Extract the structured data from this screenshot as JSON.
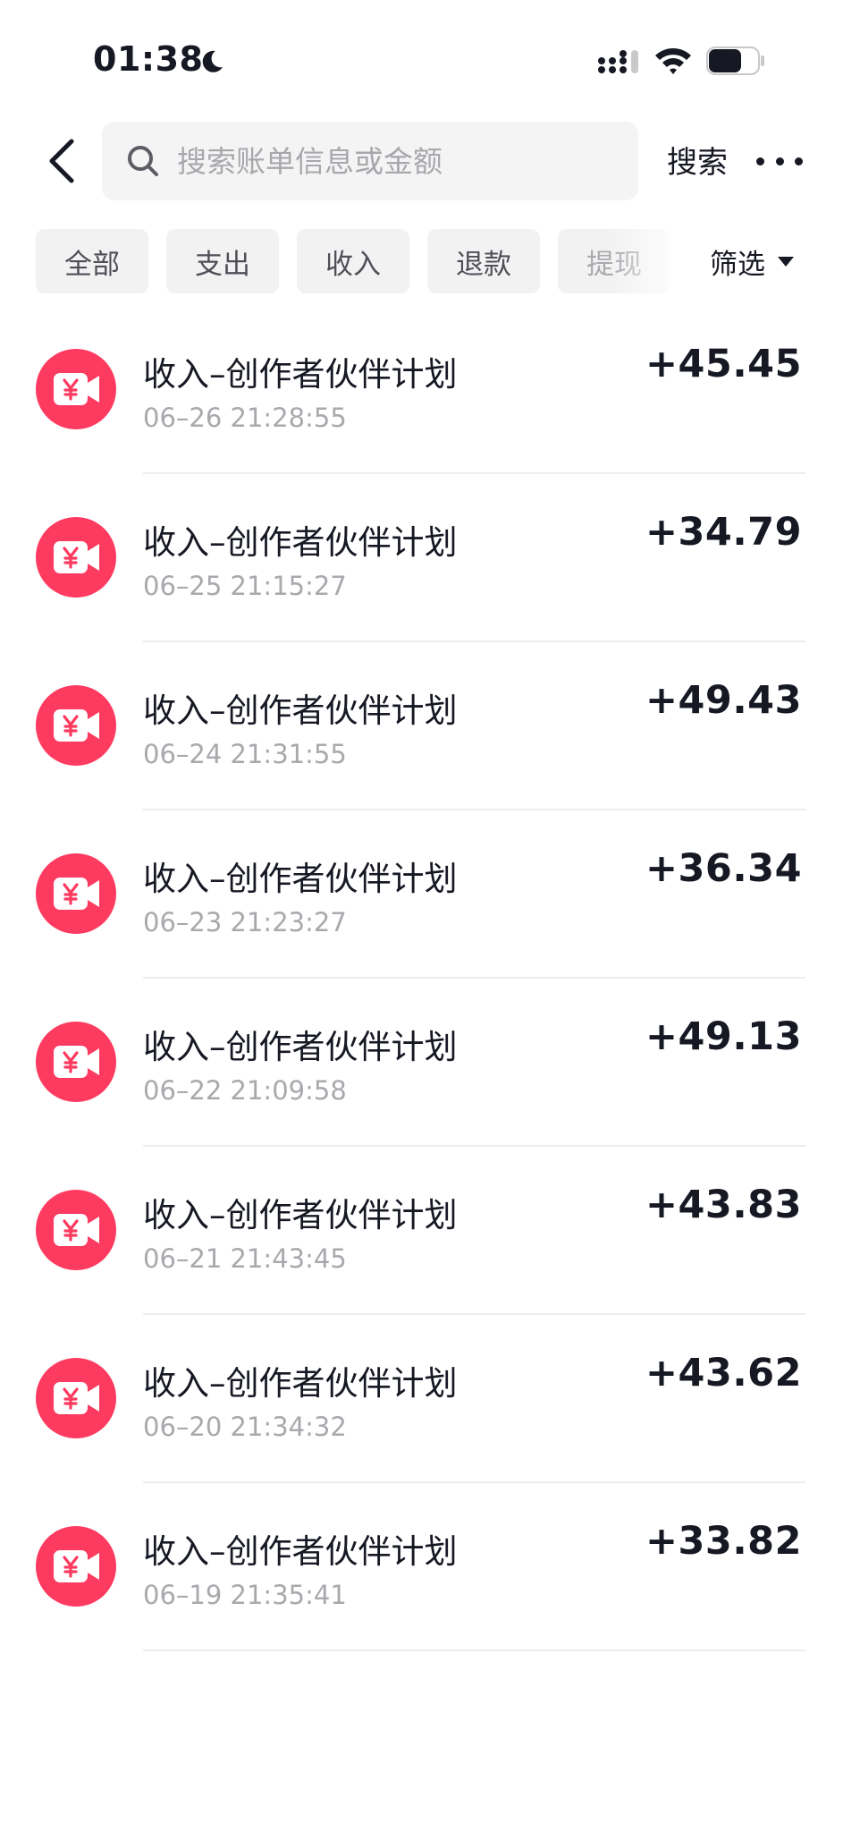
{
  "status_bar": {
    "time": "01:38"
  },
  "header": {
    "search_placeholder": "搜索账单信息或金额",
    "search_button": "搜索"
  },
  "tabs": [
    {
      "label": "全部"
    },
    {
      "label": "支出"
    },
    {
      "label": "收入"
    },
    {
      "label": "退款"
    },
    {
      "label": "提现"
    }
  ],
  "filter_label": "筛选",
  "colors": {
    "accent": "#fd3a5f",
    "text": "#161823",
    "muted": "#a8a9ad"
  },
  "transactions": [
    {
      "title": "收入–创作者伙伴计划",
      "time": "06–26 21:28:55",
      "amount": "+45.45"
    },
    {
      "title": "收入–创作者伙伴计划",
      "time": "06–25 21:15:27",
      "amount": "+34.79"
    },
    {
      "title": "收入–创作者伙伴计划",
      "time": "06–24 21:31:55",
      "amount": "+49.43"
    },
    {
      "title": "收入–创作者伙伴计划",
      "time": "06–23 21:23:27",
      "amount": "+36.34"
    },
    {
      "title": "收入–创作者伙伴计划",
      "time": "06–22 21:09:58",
      "amount": "+49.13"
    },
    {
      "title": "收入–创作者伙伴计划",
      "time": "06–21 21:43:45",
      "amount": "+43.83"
    },
    {
      "title": "收入–创作者伙伴计划",
      "time": "06–20 21:34:32",
      "amount": "+43.62"
    },
    {
      "title": "收入–创作者伙伴计划",
      "time": "06–19 21:35:41",
      "amount": "+33.82"
    }
  ],
  "row_icon": "yuan-video-icon"
}
